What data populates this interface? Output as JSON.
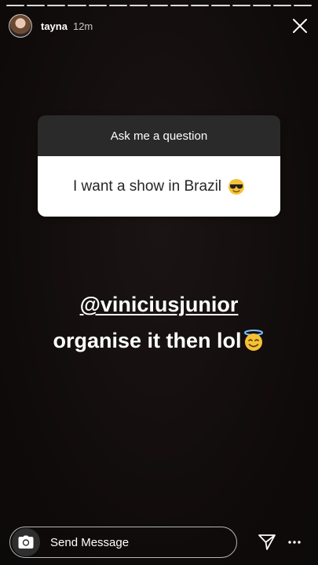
{
  "header": {
    "username": "tayna",
    "time": "12m"
  },
  "sticker": {
    "title": "Ask me a question",
    "answer": "I want a show in Brazil",
    "emoji_icon": "smiling-face-with-sunglasses-icon"
  },
  "caption": {
    "mention": "@viniciusjunior",
    "text": "organise it then lol",
    "emoji_icon": "smiling-face-with-halo-icon"
  },
  "footer": {
    "send_message_label": "Send Message",
    "camera_icon": "camera-icon",
    "send_icon": "paper-plane-icon",
    "more_icon": "more-horizontal-icon"
  },
  "progress_segments": 15,
  "colors": {
    "background": "#120d0d",
    "sticker_header": "#2b2a2b",
    "sticker_body": "#ffffff"
  }
}
